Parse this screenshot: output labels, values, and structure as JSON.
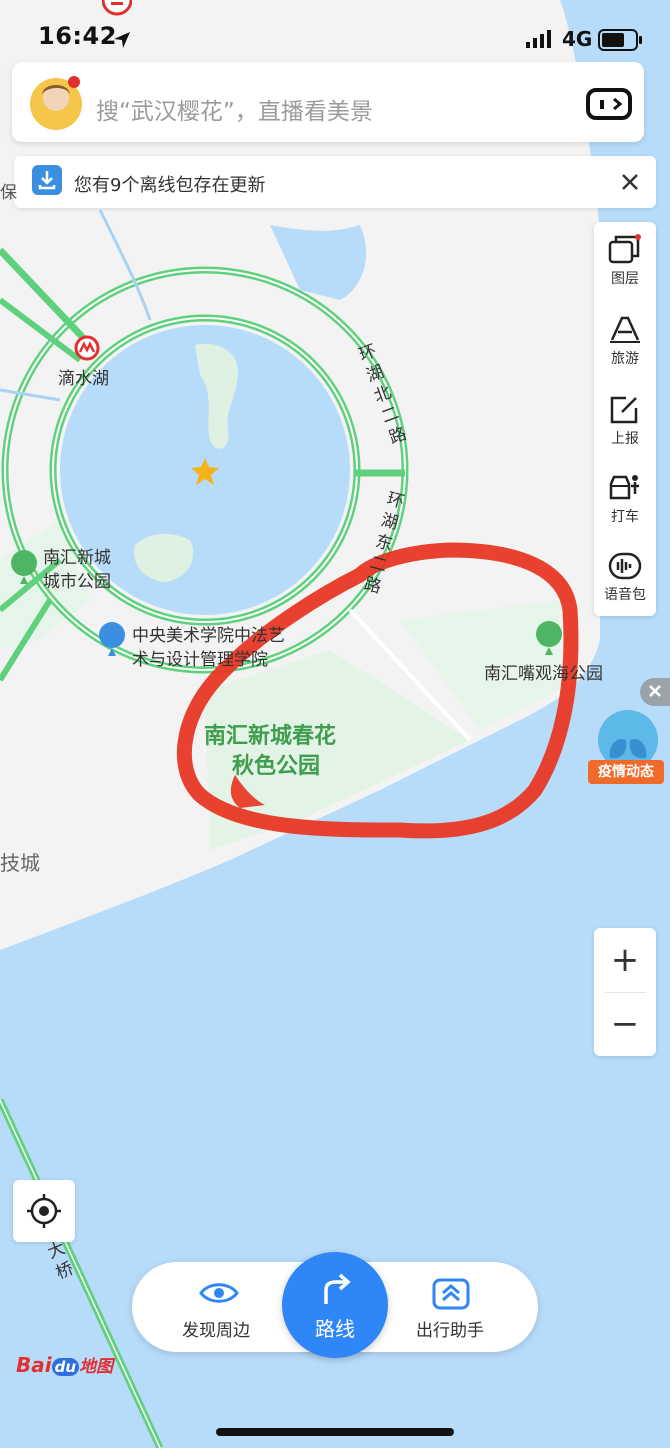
{
  "status_bar": {
    "time": "16:42",
    "network": "4G"
  },
  "search": {
    "placeholder": "搜“武汉樱花”，直播看美景"
  },
  "notice": {
    "text": "您有9个离线包存在更新"
  },
  "toolbar": {
    "items": [
      {
        "label": "图层",
        "icon": "layers-icon"
      },
      {
        "label": "旅游",
        "icon": "travel-icon"
      },
      {
        "label": "上报",
        "icon": "report-icon"
      },
      {
        "label": "打车",
        "icon": "taxi-icon"
      },
      {
        "label": "语音包",
        "icon": "voice-pack-icon"
      }
    ]
  },
  "map": {
    "labels": {
      "dishui_lake": "滴水湖",
      "huanhu_north_road": "环湖北二路",
      "huanhu_east_road": "环湖东二路",
      "nanhui_park_line1": "南汇新城",
      "nanhui_park_line2": "城市公园",
      "academy_line1": "中央美术学院中法艺",
      "academy_line2": "术与设计管理学院",
      "spring_park_line1": "南汇新城春花",
      "spring_park_line2": "秋色公园",
      "nanhuizui_park": "南汇嘴观海公园",
      "tech_city": "技城",
      "bridge": "大桥"
    }
  },
  "epidemic_badge": {
    "label": "疫情动态"
  },
  "zoom": {
    "in": "+",
    "out": "−"
  },
  "bottom_bar": {
    "discover_label": "发现周边",
    "route_label": "路线",
    "assistant_label": "出行助手"
  },
  "brand": {
    "name_part1": "Bai",
    "name_part2": "du",
    "name_part3": "地图"
  },
  "colors": {
    "accent": "#2f86f6",
    "road": "#5fd17d",
    "water": "#b7dcfa",
    "land": "#f3f3f3",
    "annotation": "#e8321e"
  }
}
